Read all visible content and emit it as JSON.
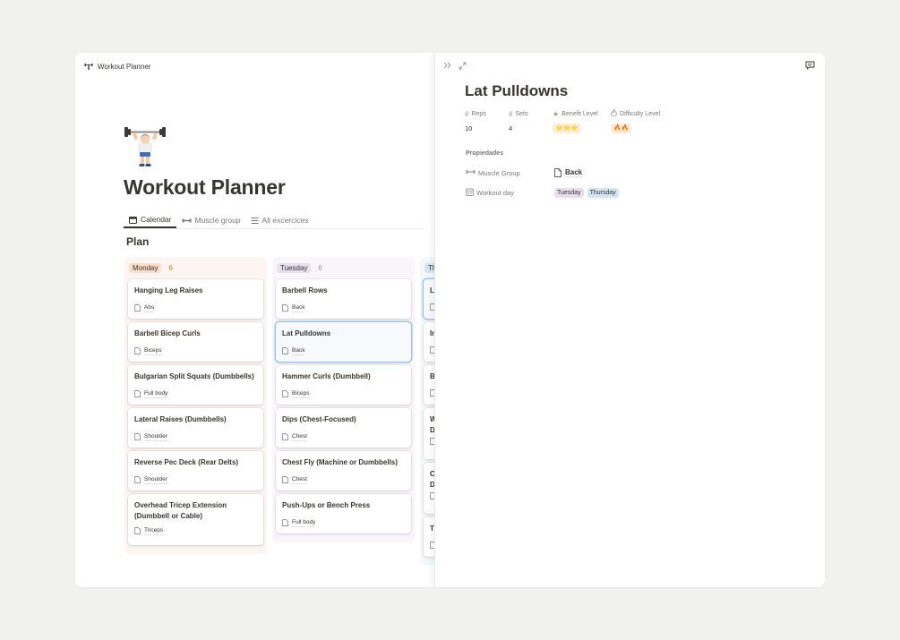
{
  "app": {
    "breadcrumb": "Workout Planner"
  },
  "page": {
    "title": "Workout Planner",
    "tabs": [
      {
        "label": "Calendar",
        "icon": "calendar-icon",
        "active": true
      },
      {
        "label": "Muscle group",
        "icon": "dumbbell-icon",
        "active": false
      },
      {
        "label": "All excercices",
        "icon": "list-icon",
        "active": false
      }
    ],
    "board_title": "Plan"
  },
  "board": {
    "columns": [
      {
        "name": "Monday",
        "count": "6",
        "tag_bg": "#fadec9",
        "col_bg": "#fcf5f1",
        "count_color": "#d9730d",
        "cards": [
          {
            "title": "Hanging Leg Raises",
            "relation": "Abs"
          },
          {
            "title": "Barbell Bicep Curls",
            "relation": "Biceps"
          },
          {
            "title": "Bulgarian Split Squats (Dumbbells)",
            "relation": "Full body"
          },
          {
            "title": "Lateral Raises (Dumbbells)",
            "relation": "Shoulder"
          },
          {
            "title": "Reverse Pec Deck (Rear Delts)",
            "relation": "Shoulder"
          },
          {
            "title": "Overhead Tricep Extension (Dumbbell or Cable)",
            "relation": "Triceps"
          }
        ]
      },
      {
        "name": "Tuesday",
        "count": "6",
        "tag_bg": "#e8deee",
        "col_bg": "#f9f6fb",
        "count_color": "#9a8c9f",
        "cards": [
          {
            "title": "Barbell Rows",
            "relation": "Back"
          },
          {
            "title": "Lat Pulldowns",
            "relation": "Back"
          },
          {
            "title": "Hammer Curls (Dumbbell)",
            "relation": "Biceps"
          },
          {
            "title": "Dips (Chest-Focused)",
            "relation": "Chest"
          },
          {
            "title": "Chest Fly (Machine or Dumbbells)",
            "relation": "Chest"
          },
          {
            "title": "Push-Ups or Bench Press",
            "relation": "Full body"
          }
        ]
      },
      {
        "name": "Th",
        "tag_bg": "#d3e5ef",
        "col_bg": "#f3f8fb",
        "cards": [
          {
            "title": "L"
          },
          {
            "title": "In"
          },
          {
            "title": "B"
          },
          {
            "title": "W D"
          },
          {
            "title": "C D"
          },
          {
            "title": "Ti"
          }
        ]
      }
    ]
  },
  "panel": {
    "title": "Lat Pulldowns",
    "properties": [
      {
        "name": "Reps",
        "icon": "hash-icon",
        "value": "10"
      },
      {
        "name": "Sets",
        "icon": "hash-icon",
        "value": "4"
      },
      {
        "name": "Benefit Level",
        "icon": "star-icon",
        "value": "⭐⭐⭐",
        "bg": "#fbecdd"
      },
      {
        "name": "Difficulty Level",
        "icon": "flame-icon",
        "value": "🔥🔥",
        "bg": "#fbecdd"
      }
    ],
    "section_label": "Propiedades",
    "muscle_group": {
      "label": "Muscle Group",
      "value": "Back"
    },
    "workout_day": {
      "label": "Workout day",
      "values": [
        {
          "text": "Tuesday",
          "bg": "#e8deee"
        },
        {
          "text": "Thursday",
          "bg": "#d3e5ef"
        }
      ]
    }
  }
}
